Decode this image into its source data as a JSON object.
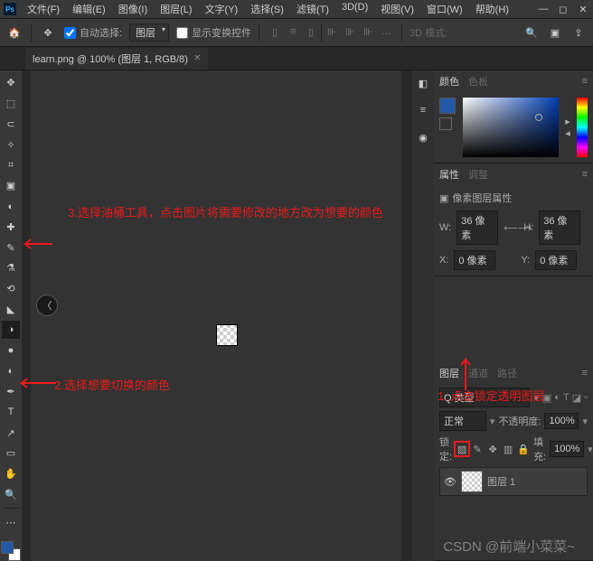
{
  "titlebar": {
    "menus": [
      "文件(F)",
      "编辑(E)",
      "图像(I)",
      "图层(L)",
      "文字(Y)",
      "选择(S)",
      "滤镜(T)",
      "3D(D)",
      "视图(V)",
      "窗口(W)",
      "帮助(H)"
    ]
  },
  "optbar": {
    "auto_select": "自动选择:",
    "auto_select_value": "图层",
    "show_transform": "显示变换控件",
    "mode_label": "3D 模式:"
  },
  "tab": {
    "title": "learn.png @ 100% (图层 1, RGB/8)"
  },
  "tools": [
    {
      "name": "move",
      "glyph": "✥"
    },
    {
      "name": "marquee",
      "glyph": "⬚"
    },
    {
      "name": "lasso",
      "glyph": "⊂"
    },
    {
      "name": "wand",
      "glyph": "✧"
    },
    {
      "name": "crop",
      "glyph": "⌗"
    },
    {
      "name": "frame",
      "glyph": "▣"
    },
    {
      "name": "eyedrop",
      "glyph": "◐"
    },
    {
      "name": "heal",
      "glyph": "✚"
    },
    {
      "name": "brush",
      "glyph": "✎"
    },
    {
      "name": "stamp",
      "glyph": "⚗"
    },
    {
      "name": "history",
      "glyph": "⟲"
    },
    {
      "name": "eraser",
      "glyph": "◣"
    },
    {
      "name": "bucket",
      "glyph": "◑",
      "selected": true
    },
    {
      "name": "blur",
      "glyph": "●"
    },
    {
      "name": "dodge",
      "glyph": "◐"
    },
    {
      "name": "pen",
      "glyph": "✒"
    },
    {
      "name": "text",
      "glyph": "T"
    },
    {
      "name": "path",
      "glyph": "↗"
    },
    {
      "name": "shape",
      "glyph": "▭"
    },
    {
      "name": "hand",
      "glyph": "✋"
    },
    {
      "name": "zoom",
      "glyph": "🔍"
    }
  ],
  "vstrip": [
    {
      "glyph": "◧"
    },
    {
      "glyph": "≡"
    },
    {
      "glyph": "◉"
    }
  ],
  "color_panel": {
    "tab1": "颜色",
    "tab2": "色板"
  },
  "props_panel": {
    "tab1": "属性",
    "tab2": "调整",
    "subtitle": "像素图层属性",
    "w_label": "W:",
    "w_value": "36 像素",
    "h_label": "H:",
    "h_value": "36 像素",
    "x_label": "X:",
    "x_value": "0 像素",
    "y_label": "Y:",
    "y_value": "0 像素"
  },
  "layers_panel": {
    "tabs": [
      "图层",
      "通道",
      "路径"
    ],
    "kind": "Q 类型",
    "blend": "正常",
    "opacity_label": "不透明度:",
    "opacity": "100%",
    "lock_label": "锁定:",
    "fill_label": "填充:",
    "fill": "100%",
    "layer_name": "图层 1"
  },
  "annotations": {
    "a1": "1. 点击锁定透明图层",
    "a2": "2.选择想要切换的颜色",
    "a3": "3.选择油桶工具，点击图片将需要修改的地方改为想要的颜色"
  },
  "watermark": "CSDN @前端小菜菜~"
}
